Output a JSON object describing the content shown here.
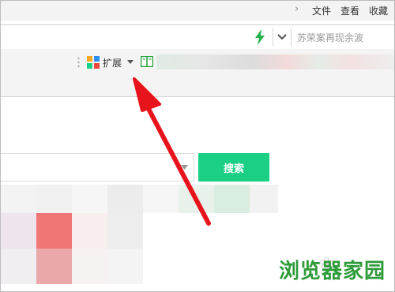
{
  "menu": {
    "chevron": "›",
    "items": [
      "文件",
      "查看",
      "收藏"
    ]
  },
  "address_bar": {
    "search_placeholder": "苏荣案再现余波"
  },
  "toolbar": {
    "extensions_label": "扩展"
  },
  "search": {
    "button_label": "搜索"
  },
  "watermark": {
    "text": "浏览器家园"
  },
  "colors": {
    "accent_green": "#1bd084",
    "arrow_red": "#e8141c",
    "watermark_green": "#2e9b3a"
  }
}
